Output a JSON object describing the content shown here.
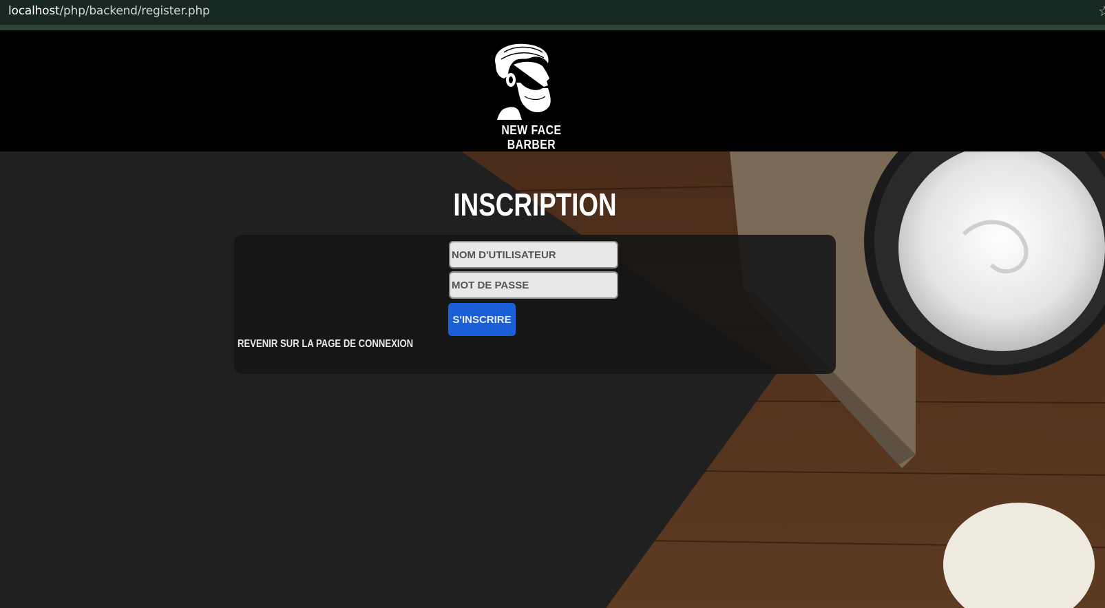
{
  "browser": {
    "url_host": "localhost",
    "url_path": "/php/backend/register.php",
    "star_icon": "star-icon"
  },
  "header": {
    "logo_text": "NEW FACE BARBER",
    "logo_icon": "barber-head-logo"
  },
  "page": {
    "title": "INSCRIPTION"
  },
  "form": {
    "username_placeholder": "NOM D'UTILISATEUR",
    "password_placeholder": "MOT DE PASSE",
    "submit_label": "S'INSCRIRE",
    "back_link": "REVENIR SUR LA PAGE DE CONNEXION"
  },
  "colors": {
    "button": "#1a5fd8",
    "header_bg": "#000000",
    "card_bg": "#141414"
  }
}
